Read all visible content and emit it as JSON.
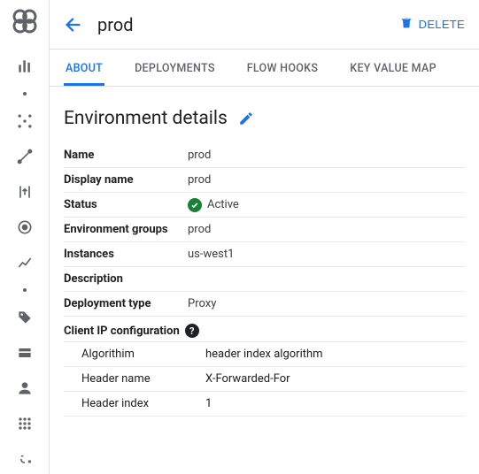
{
  "header": {
    "title": "prod",
    "delete_label": "DELETE"
  },
  "tabs": {
    "about": "ABOUT",
    "deployments": "DEPLOYMENTS",
    "flow_hooks": "FLOW HOOKS",
    "kvm": "KEY VALUE MAP"
  },
  "section": {
    "title": "Environment details"
  },
  "details": {
    "name_label": "Name",
    "name_value": "prod",
    "display_name_label": "Display name",
    "display_name_value": "prod",
    "status_label": "Status",
    "status_value": "Active",
    "env_groups_label": "Environment groups",
    "env_groups_value": "prod",
    "instances_label": "Instances",
    "instances_value": "us-west1",
    "description_label": "Description",
    "description_value": "",
    "deployment_type_label": "Deployment type",
    "deployment_type_value": "Proxy"
  },
  "client_ip": {
    "title": "Client IP configuration",
    "algorithm_label": "Algorithim",
    "algorithm_value": "header index algorithm",
    "header_name_label": "Header name",
    "header_name_value": "X-Forwarded-For",
    "header_index_label": "Header index",
    "header_index_value": "1"
  }
}
